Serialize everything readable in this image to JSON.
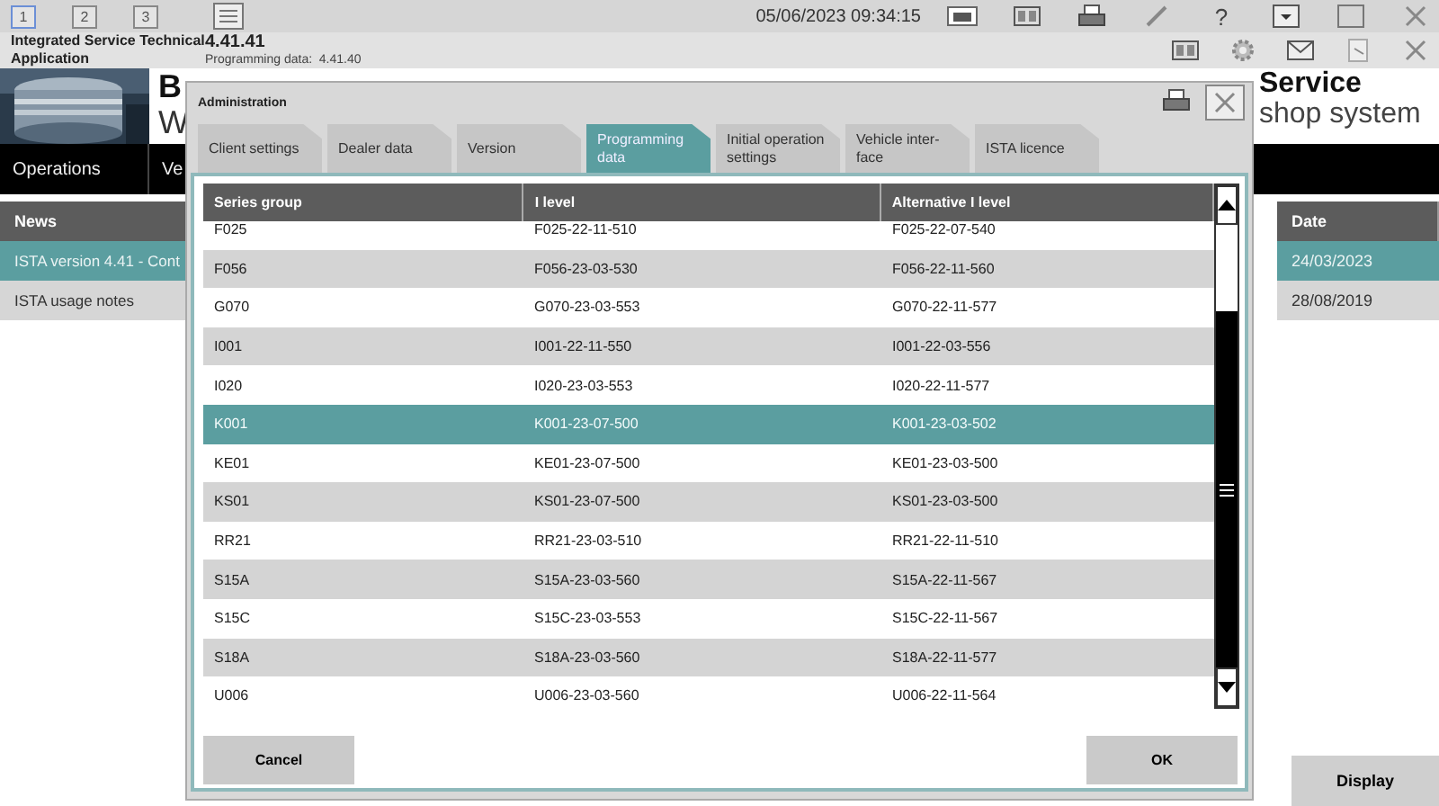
{
  "top_bar": {
    "screens": [
      {
        "label": "1",
        "selected": true
      },
      {
        "label": "2",
        "selected": false
      },
      {
        "label": "3",
        "selected": false
      }
    ],
    "datetime": "05/06/2023 09:34:15",
    "help": "?"
  },
  "app": {
    "title": "Integrated Service Technical Application",
    "version": "4.41.41",
    "programming_label": "Programming data:",
    "programming_version": "4.41.40"
  },
  "header": {
    "brand_line1": "B",
    "brand_line2": "W",
    "title_line1": "Service",
    "title_line2": "shop system"
  },
  "nav": [
    "Operations",
    "Ve"
  ],
  "news": {
    "columns": [
      "News",
      "Date"
    ],
    "rows": [
      {
        "title": "ISTA version 4.41 - Cont",
        "date": "24/03/2023",
        "selected": true
      },
      {
        "title": "ISTA usage notes",
        "date": "28/08/2019",
        "selected": false
      }
    ]
  },
  "display_button": "Display",
  "dialog": {
    "title": "Administration",
    "tabs": [
      {
        "label": "Client settings",
        "selected": false
      },
      {
        "label": "Dealer data",
        "selected": false
      },
      {
        "label": "Version",
        "selected": false
      },
      {
        "label": "Programming data",
        "selected": true
      },
      {
        "label": "Initial operation settings",
        "selected": false
      },
      {
        "label": "Vehicle inter-face",
        "selected": false
      },
      {
        "label": "ISTA licence",
        "selected": false
      }
    ],
    "table": {
      "columns": [
        "Series group",
        "I level",
        "Alternative I level"
      ],
      "rows": [
        {
          "series": "F025",
          "i_level": "F025-22-11-510",
          "alt": "F025-22-07-540",
          "selected": false
        },
        {
          "series": "F056",
          "i_level": "F056-23-03-530",
          "alt": "F056-22-11-560",
          "selected": false
        },
        {
          "series": "G070",
          "i_level": "G070-23-03-553",
          "alt": "G070-22-11-577",
          "selected": false
        },
        {
          "series": "I001",
          "i_level": "I001-22-11-550",
          "alt": "I001-22-03-556",
          "selected": false
        },
        {
          "series": "I020",
          "i_level": "I020-23-03-553",
          "alt": "I020-22-11-577",
          "selected": false
        },
        {
          "series": "K001",
          "i_level": "K001-23-07-500",
          "alt": "K001-23-03-502",
          "selected": true
        },
        {
          "series": "KE01",
          "i_level": "KE01-23-07-500",
          "alt": "KE01-23-03-500",
          "selected": false
        },
        {
          "series": "KS01",
          "i_level": "KS01-23-07-500",
          "alt": "KS01-23-03-500",
          "selected": false
        },
        {
          "series": "RR21",
          "i_level": "RR21-23-03-510",
          "alt": "RR21-22-11-510",
          "selected": false
        },
        {
          "series": "S15A",
          "i_level": "S15A-23-03-560",
          "alt": "S15A-22-11-567",
          "selected": false
        },
        {
          "series": "S15C",
          "i_level": "S15C-23-03-553",
          "alt": "S15C-22-11-567",
          "selected": false
        },
        {
          "series": "S18A",
          "i_level": "S18A-23-03-560",
          "alt": "S18A-22-11-577",
          "selected": false
        },
        {
          "series": "U006",
          "i_level": "U006-23-03-560",
          "alt": "U006-22-11-564",
          "selected": false
        }
      ]
    },
    "buttons": [
      "Cancel",
      "OK"
    ]
  }
}
